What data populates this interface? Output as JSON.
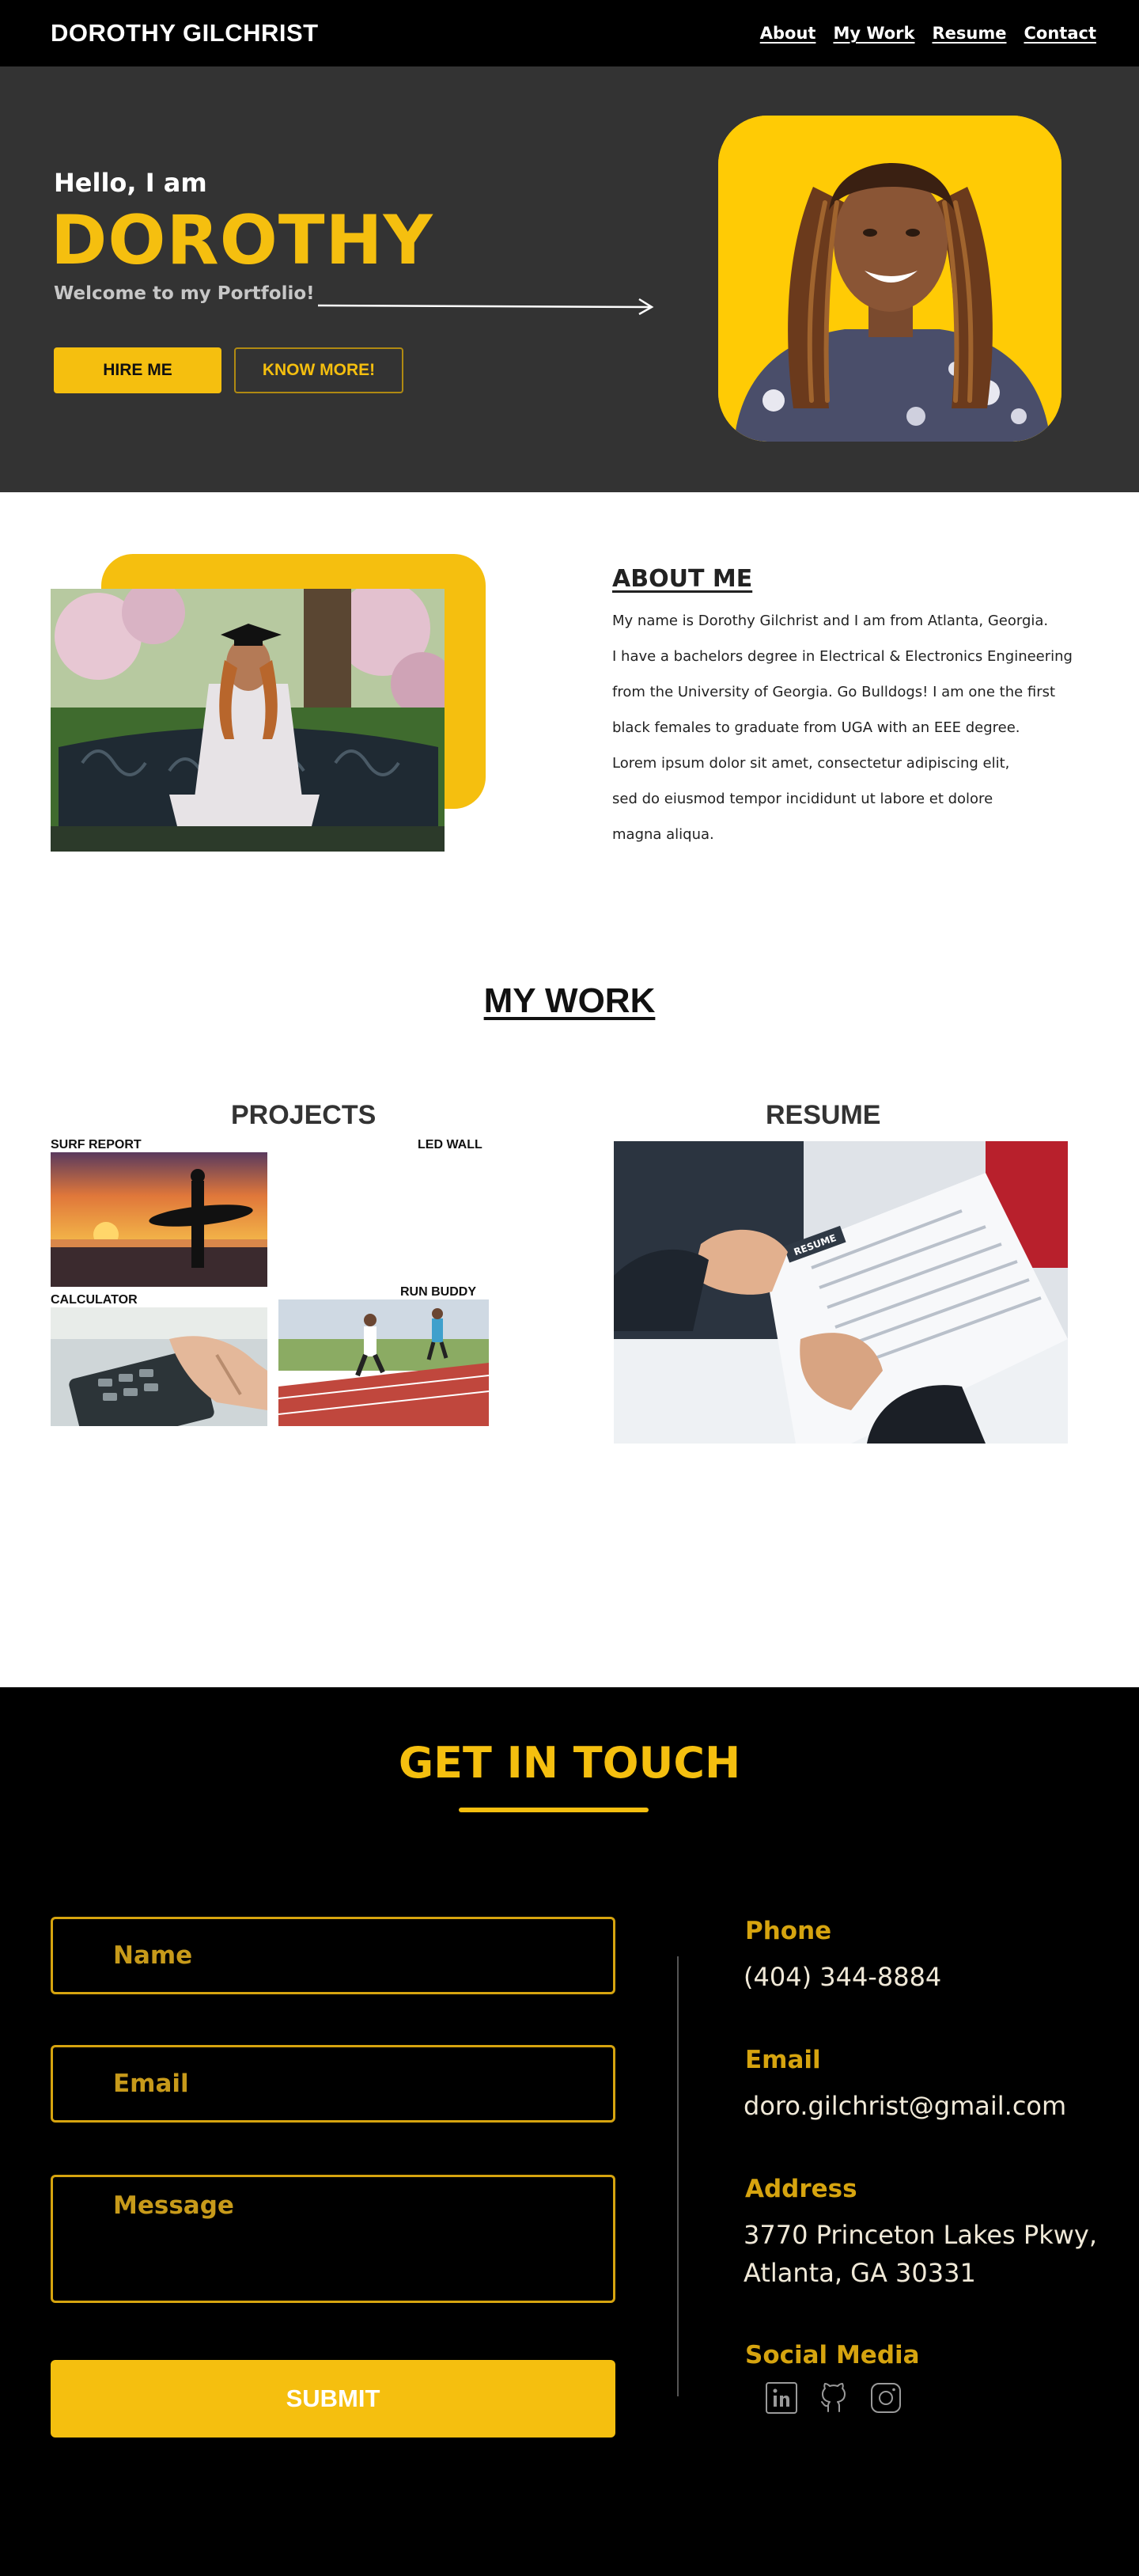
{
  "nav": {
    "brand": "DOROTHY GILCHRIST",
    "links": [
      "About",
      "My Work",
      "Resume",
      "Contact"
    ]
  },
  "hero": {
    "hello": "Hello, I am",
    "name": "DOROTHY",
    "welcome": "Welcome to my Portfolio!",
    "hire_button": "HIRE ME",
    "know_button": "KNOW MORE!"
  },
  "about": {
    "title": "ABOUT ME",
    "lines": [
      "My name is Dorothy Gilchrist and I am from Atlanta, Georgia.",
      "I have a bachelors degree in Electrical & Electronics Engineering",
      "from the University of Georgia. Go Bulldogs! I am one the first",
      "black females to graduate from UGA with an EEE degree.",
      "Lorem ipsum dolor sit amet, consectetur adipiscing elit,",
      "sed do eiusmod tempor incididunt ut labore et dolore",
      "magna aliqua."
    ]
  },
  "work": {
    "title": "MY WORK",
    "projects_title": "PROJECTS",
    "resume_title": "RESUME",
    "projects": [
      {
        "label": "SURF REPORT"
      },
      {
        "label": "LED WALL"
      },
      {
        "label": "CALCULATOR"
      },
      {
        "label": "RUN BUDDY"
      }
    ],
    "resume_badge": "RESUME"
  },
  "contact": {
    "title": "GET IN TOUCH",
    "form": {
      "name_placeholder": "Name",
      "email_placeholder": "Email",
      "message_placeholder": "Message",
      "submit": "SUBMIT"
    },
    "phone_label": "Phone",
    "phone": "(404) 344-8884",
    "email_label": "Email",
    "email": "doro.gilchrist@gmail.com",
    "address_label": "Address",
    "address_line1": "3770 Princeton Lakes Pkwy,",
    "address_line2": "Atlanta, GA 30331",
    "social_label": "Social Media",
    "social_icons": [
      "linkedin-icon",
      "github-icon",
      "instagram-icon"
    ]
  },
  "colors": {
    "accent": "#f5bf0f",
    "hero_bg": "#333333",
    "footer_bg": "#000000"
  }
}
